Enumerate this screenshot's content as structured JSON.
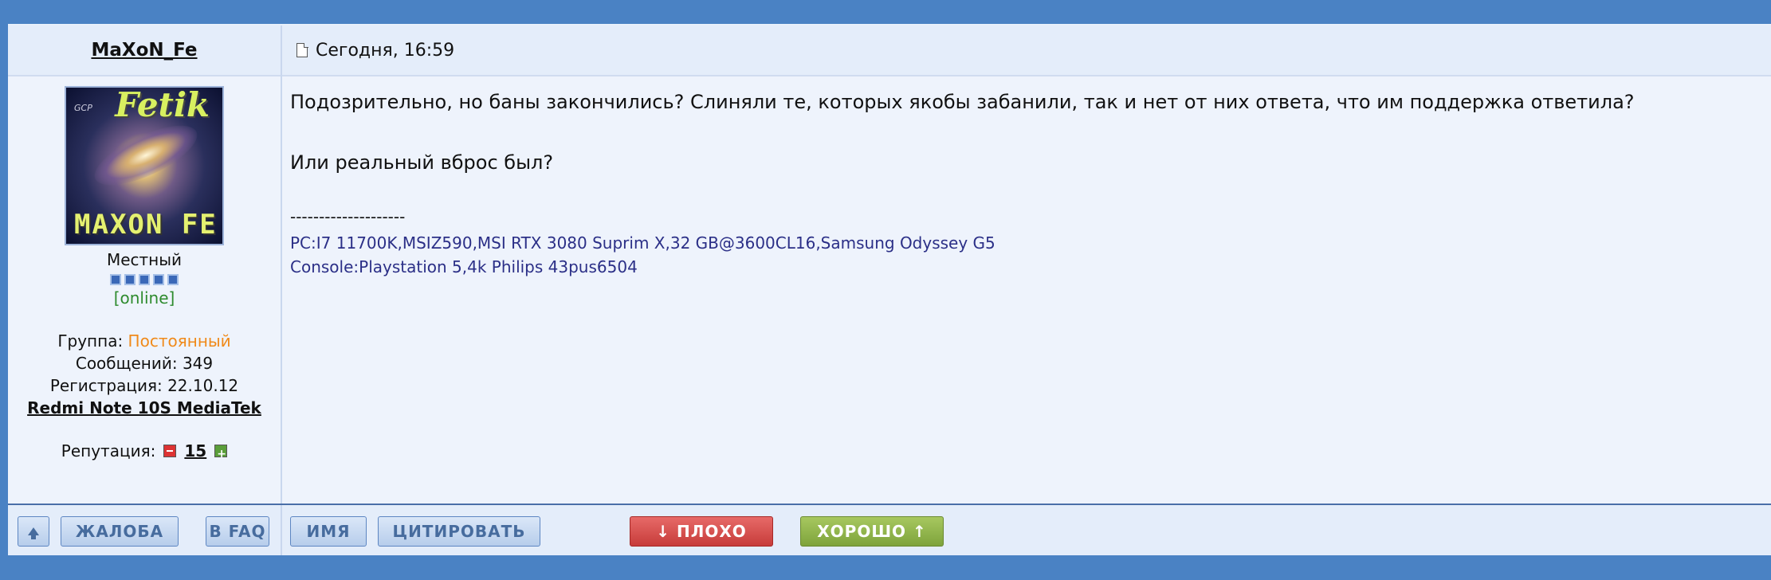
{
  "post": {
    "author": "MaXoN_Fe",
    "date": "Сегодня, 16:59",
    "user": {
      "rank": "Местный",
      "status": "[online]",
      "group_label": "Группа:",
      "group_value": "Постоянный",
      "posts_label": "Сообщений:",
      "posts_value": "349",
      "reg_label": "Регистрация:",
      "reg_value": "22.10.12",
      "device": "Redmi Note 10S MediaTek ",
      "rep_label": "Репутация:",
      "rep_value": "15",
      "avatar_text_top": "Fetik",
      "avatar_text_bottom": "MAXON FE",
      "avatar_text_small": "GCP"
    },
    "body": {
      "p1": "Подозрительно, но баны закончились? Слиняли те, которых якобы забанили, так и нет от них ответа, что им поддержка ответила?",
      "p2": "Или реальный вброс был?",
      "sig_sep": "--------------------",
      "sig1": "PC:I7 11700K,MSIZ590,MSI RTX 3080 Suprim X,32 GB@3600CL16,Samsung Odyssey G5",
      "sig2": "Console:Playstation 5,4k Philips 43pus6504"
    },
    "actions": {
      "report": "ЖАЛОБА",
      "faq": "В FAQ",
      "name": "ИМЯ",
      "quote": "ЦИТИРОВАТЬ",
      "bad": "↓ ПЛОХО",
      "good": "ХОРОШО ↑"
    }
  },
  "colors": {
    "frame": "#4a82c4",
    "post_bg": "#eef3fc",
    "group": "#f08a1a",
    "online": "#2e8b2e",
    "signature": "#2b2f87"
  }
}
